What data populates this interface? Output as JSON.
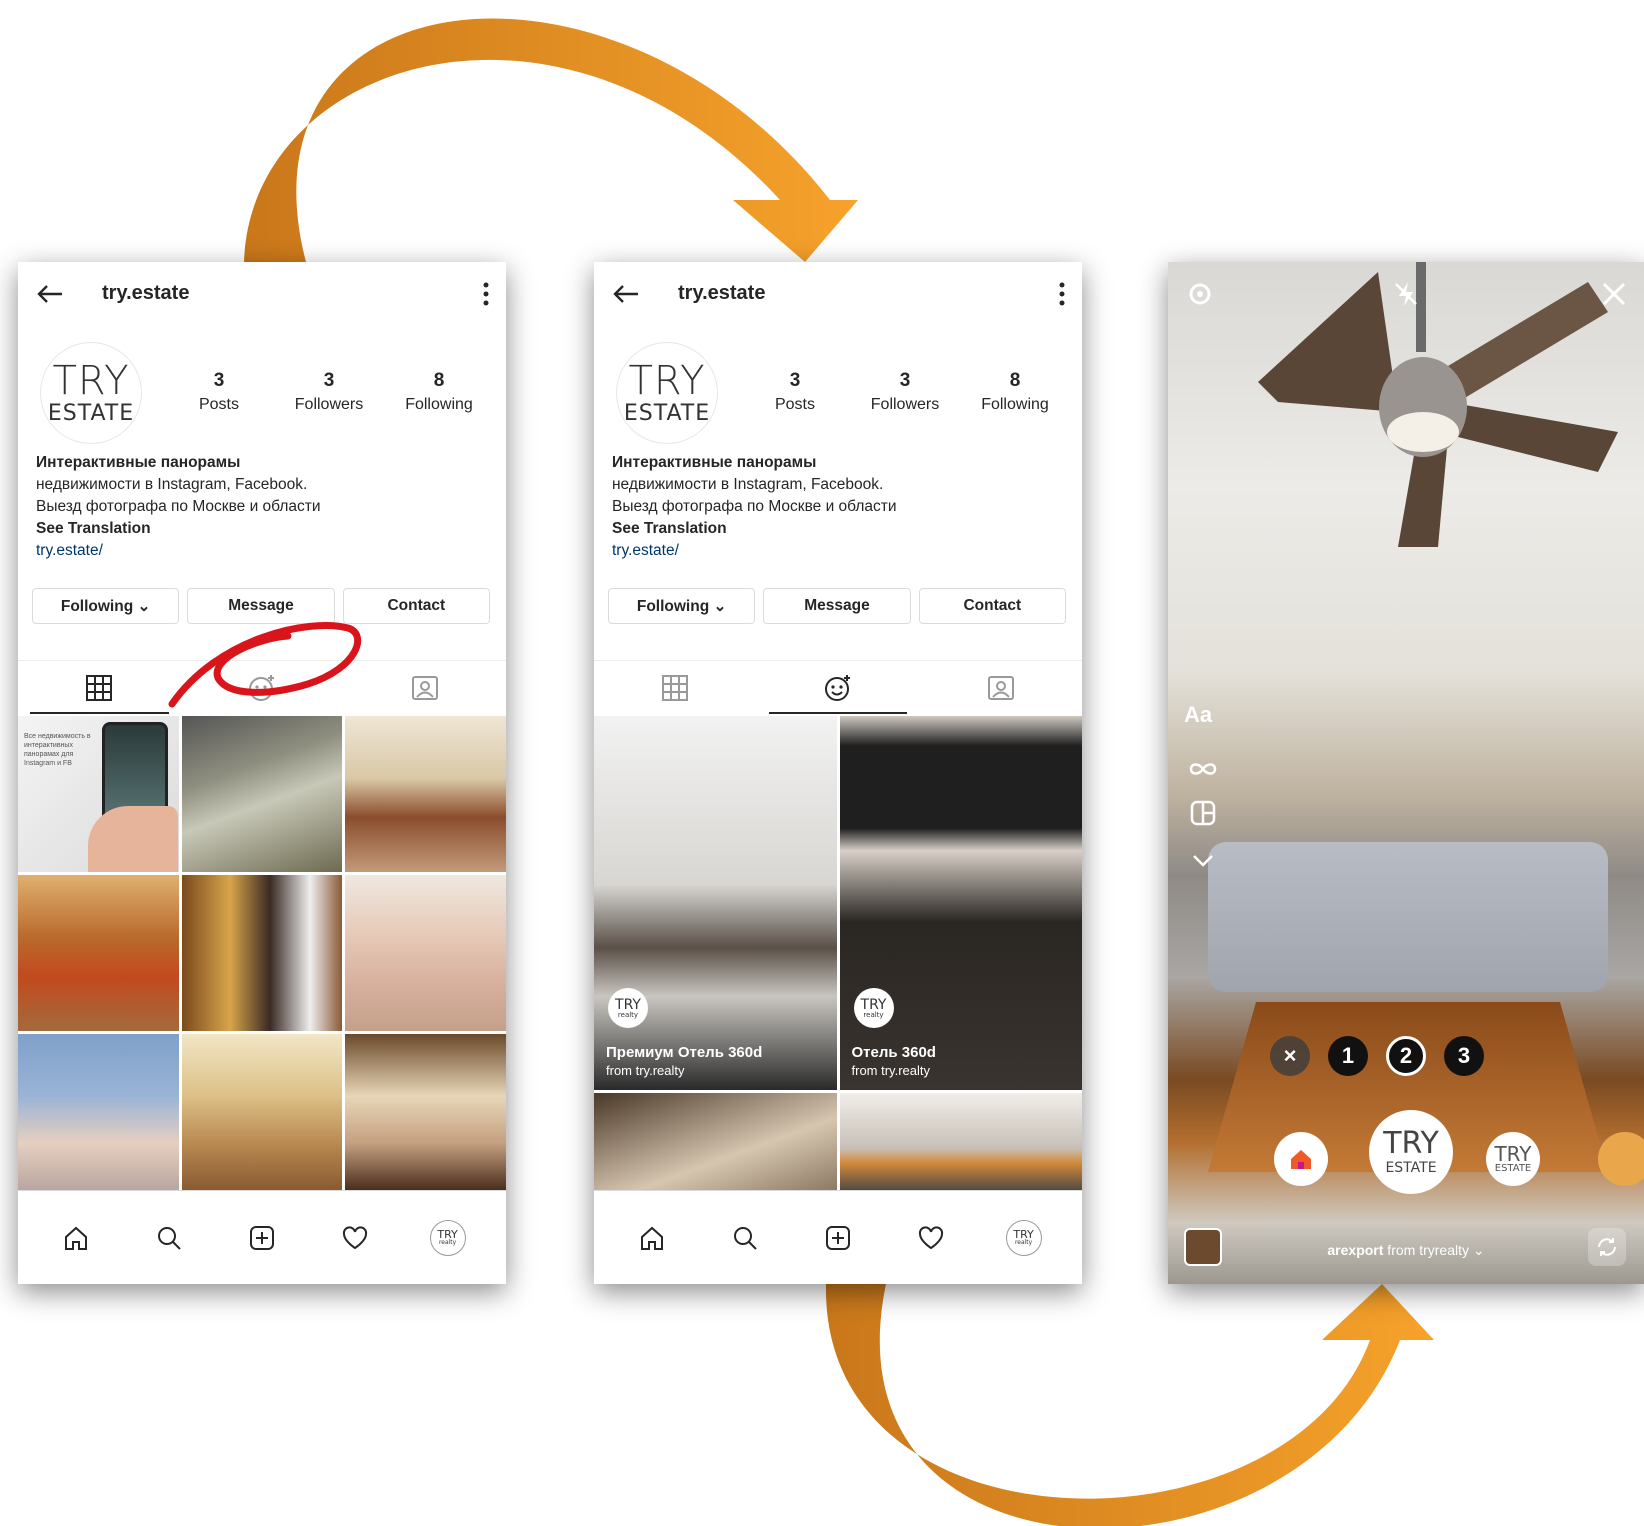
{
  "profile": {
    "username": "try.estate",
    "logo_line1": "TRY",
    "logo_line2": "ESTATE",
    "stats": [
      {
        "value": "3",
        "label": "Posts"
      },
      {
        "value": "3",
        "label": "Followers"
      },
      {
        "value": "8",
        "label": "Following"
      }
    ],
    "bio_title": "Интерактивные панорамы",
    "bio_line2": "недвижимости в Instagram, Facebook.",
    "bio_line3": "Выезд фотографа по Москве и области",
    "see_translation": "See Translation",
    "website": "try.estate/",
    "buttons": {
      "following": "Following ⌄",
      "message": "Message",
      "contact": "Contact"
    }
  },
  "post_thumb_text": "Все недвижимость в интерактивных панорамах для Instagram и FB",
  "effects": [
    {
      "title": "Премиум Отель 360d",
      "from": "from try.realty",
      "logo1": "TRY",
      "logo2": "realty"
    },
    {
      "title": "Отель 360d",
      "from": "from try.realty",
      "logo1": "TRY",
      "logo2": "realty"
    }
  ],
  "nav_avatar": {
    "line1": "TRY",
    "line2": "realty"
  },
  "camera": {
    "text_tool": "Aa",
    "picker": [
      "×",
      "1",
      "2",
      "3"
    ],
    "shutter_line1": "TRY",
    "shutter_line2": "ESTATE",
    "credit_user": "arexport",
    "credit_rest": " from tryrealty ⌄"
  },
  "colors": {
    "arrow": "#f09a1e",
    "annotation": "#d9141b",
    "link": "#00376b"
  }
}
